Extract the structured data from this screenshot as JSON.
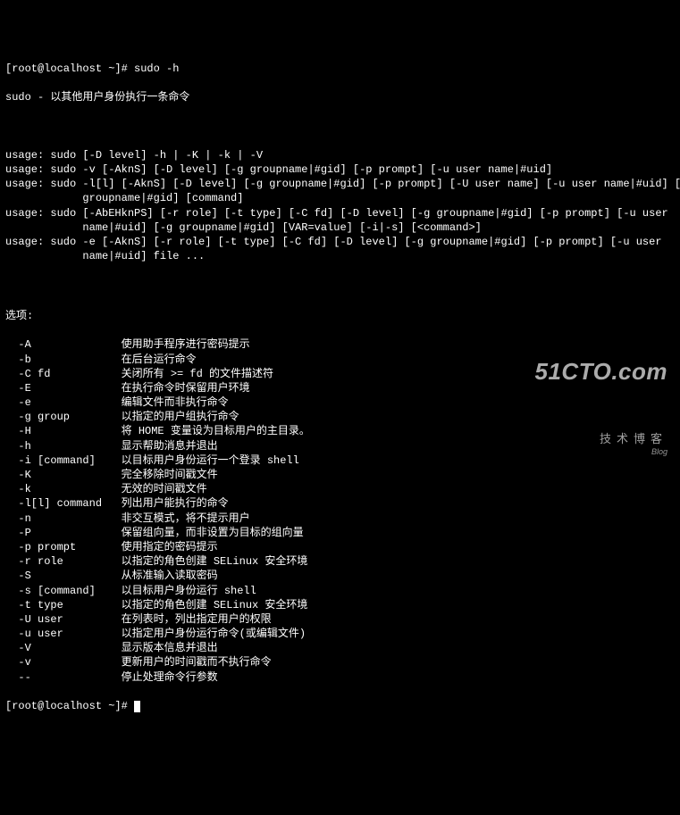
{
  "prompt1": "[root@localhost ~]# ",
  "cmd1": "sudo -h",
  "desc": "sudo - 以其他用户身份执行一条命令",
  "usages": [
    "usage: sudo [-D level] -h | -K | -k | -V",
    "usage: sudo -v [-AknS] [-D level] [-g groupname|#gid] [-p prompt] [-u user name|#uid]",
    "usage: sudo -l[l] [-AknS] [-D level] [-g groupname|#gid] [-p prompt] [-U user name] [-u user name|#uid] [-g",
    "            groupname|#gid] [command]",
    "usage: sudo [-AbEHknPS] [-r role] [-t type] [-C fd] [-D level] [-g groupname|#gid] [-p prompt] [-u user",
    "            name|#uid] [-g groupname|#gid] [VAR=value] [-i|-s] [<command>]",
    "usage: sudo -e [-AknS] [-r role] [-t type] [-C fd] [-D level] [-g groupname|#gid] [-p prompt] [-u user",
    "            name|#uid] file ..."
  ],
  "options_header": "选项:",
  "options": [
    {
      "flag": "  -A",
      "desc": "使用助手程序进行密码提示"
    },
    {
      "flag": "  -b",
      "desc": "在后台运行命令"
    },
    {
      "flag": "  -C fd",
      "desc": "关闭所有 >= fd 的文件描述符"
    },
    {
      "flag": "  -E",
      "desc": "在执行命令时保留用户环境"
    },
    {
      "flag": "  -e",
      "desc": "编辑文件而非执行命令"
    },
    {
      "flag": "  -g group",
      "desc": "以指定的用户组执行命令"
    },
    {
      "flag": "  -H",
      "desc": "将 HOME 变量设为目标用户的主目录。"
    },
    {
      "flag": "  -h",
      "desc": "显示帮助消息并退出"
    },
    {
      "flag": "  -i [command]",
      "desc": "以目标用户身份运行一个登录 shell"
    },
    {
      "flag": "  -K",
      "desc": "完全移除时间戳文件"
    },
    {
      "flag": "  -k",
      "desc": "无效的时间戳文件"
    },
    {
      "flag": "  -l[l] command",
      "desc": "列出用户能执行的命令"
    },
    {
      "flag": "  -n",
      "desc": "非交互模式，将不提示用户"
    },
    {
      "flag": "  -P",
      "desc": "保留组向量，而非设置为目标的组向量"
    },
    {
      "flag": "  -p prompt",
      "desc": "使用指定的密码提示"
    },
    {
      "flag": "  -r role",
      "desc": "以指定的角色创建 SELinux 安全环境"
    },
    {
      "flag": "  -S",
      "desc": "从标准输入读取密码"
    },
    {
      "flag": "  -s [command]",
      "desc": "以目标用户身份运行 shell"
    },
    {
      "flag": "  -t type",
      "desc": "以指定的角色创建 SELinux 安全环境"
    },
    {
      "flag": "  -U user",
      "desc": "在列表时，列出指定用户的权限"
    },
    {
      "flag": "  -u user",
      "desc": "以指定用户身份运行命令(或编辑文件)"
    },
    {
      "flag": "  -V",
      "desc": "显示版本信息并退出"
    },
    {
      "flag": "  -v",
      "desc": "更新用户的时间戳而不执行命令"
    },
    {
      "flag": "  --",
      "desc": "停止处理命令行参数"
    }
  ],
  "prompt2": "[root@localhost ~]# ",
  "watermark": {
    "main": "51CTO.com",
    "sub": "技术博客",
    "blog": "Blog"
  }
}
